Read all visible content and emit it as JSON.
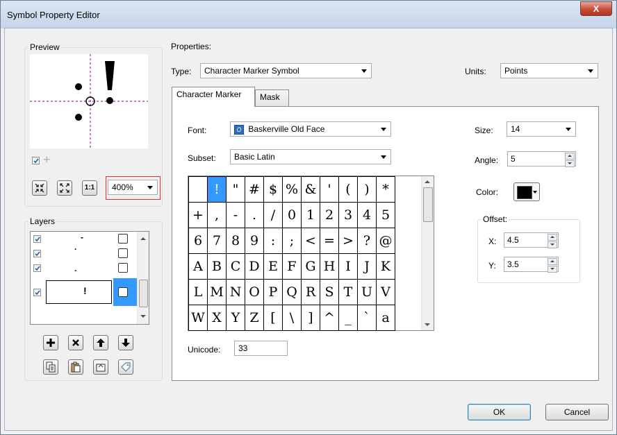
{
  "window": {
    "title": "Symbol Property Editor",
    "close_label": "X"
  },
  "preview": {
    "group_label": "Preview",
    "zoom": "400%"
  },
  "layers": {
    "group_label": "Layers",
    "rows": [
      {
        "glyph": "-",
        "checked": true
      },
      {
        "glyph": "·",
        "checked": true
      },
      {
        "glyph": ".",
        "checked": true
      },
      {
        "glyph": "!",
        "checked": true,
        "selected": true
      }
    ]
  },
  "properties": {
    "group_label": "Properties:",
    "type_label": "Type:",
    "type_value": "Character Marker Symbol",
    "units_label": "Units:",
    "units_value": "Points",
    "tabs": [
      "Character Marker",
      "Mask"
    ],
    "font_label": "Font:",
    "font_value": "Baskerville Old Face",
    "subset_label": "Subset:",
    "subset_value": "Basic Latin",
    "size_label": "Size:",
    "size_value": "14",
    "angle_label": "Angle:",
    "angle_value": "5",
    "color_label": "Color:",
    "color_value": "#000000",
    "offset_label": "Offset:",
    "x_label": "X:",
    "x_value": "4.5",
    "y_label": "Y:",
    "y_value": "3.5",
    "unicode_label": "Unicode:",
    "unicode_value": "33"
  },
  "char_grid": [
    [
      "",
      "!",
      "\"",
      "#",
      "$",
      "%",
      "&",
      "'",
      "(",
      ")",
      "*"
    ],
    [
      "+",
      ",",
      "-",
      ".",
      "/",
      "0",
      "1",
      "2",
      "3",
      "4",
      "5"
    ],
    [
      "6",
      "7",
      "8",
      "9",
      ":",
      ";",
      "<",
      "=",
      ">",
      "?",
      "@"
    ],
    [
      "A",
      "B",
      "C",
      "D",
      "E",
      "F",
      "G",
      "H",
      "I",
      "J",
      "K"
    ],
    [
      "L",
      "M",
      "N",
      "O",
      "P",
      "Q",
      "R",
      "S",
      "T",
      "U",
      "V"
    ],
    [
      "W",
      "X",
      "Y",
      "Z",
      "[",
      "\\",
      "]",
      "^",
      "_",
      "`",
      "a"
    ]
  ],
  "buttons": {
    "ok": "OK",
    "cancel": "Cancel"
  }
}
